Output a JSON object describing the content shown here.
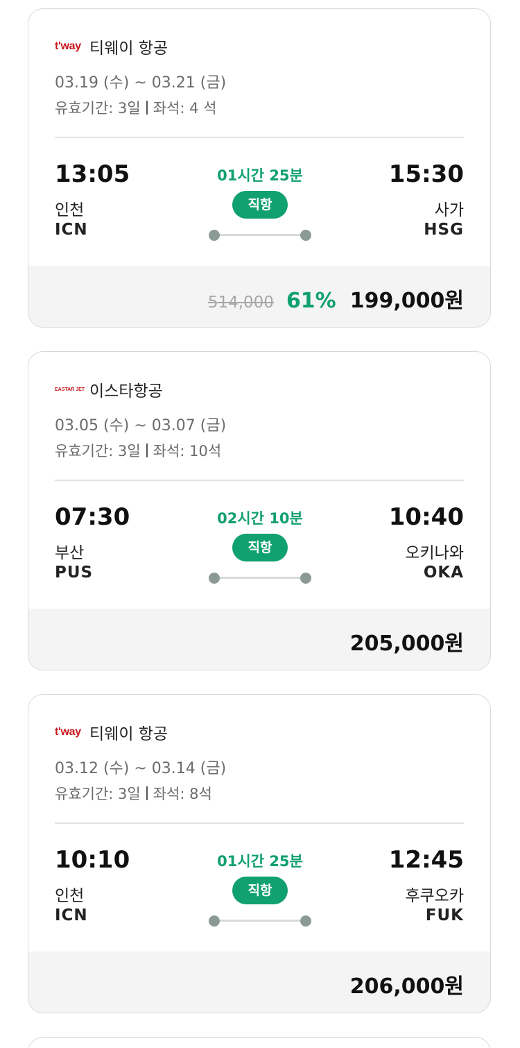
{
  "flights": [
    {
      "airline_logo": "t'way",
      "airline_logo_style": "tway",
      "airline_name": "티웨이 항공",
      "dates": "03.19 (수) ~ 03.21 (금)",
      "validity_label": "유효기간: 3일",
      "seats_label": "좌석: 4 석",
      "dep_time": "13:05",
      "dep_city": "인천",
      "dep_code": "ICN",
      "duration": "01시간 25분",
      "flight_type": "직항",
      "arr_time": "15:30",
      "arr_city": "사가",
      "arr_code": "HSG",
      "original_price": "514,000",
      "discount": "61%",
      "price": "199,000원"
    },
    {
      "airline_logo": "EASTAR JET",
      "airline_logo_style": "eastar",
      "airline_name": "이스타항공",
      "dates": "03.05 (수) ~ 03.07 (금)",
      "validity_label": "유효기간: 3일",
      "seats_label": "좌석: 10석",
      "dep_time": "07:30",
      "dep_city": "부산",
      "dep_code": "PUS",
      "duration": "02시간 10분",
      "flight_type": "직항",
      "arr_time": "10:40",
      "arr_city": "오키나와",
      "arr_code": "OKA",
      "original_price": "",
      "discount": "",
      "price": "205,000원"
    },
    {
      "airline_logo": "t'way",
      "airline_logo_style": "tway",
      "airline_name": "티웨이 항공",
      "dates": "03.12 (수) ~ 03.14 (금)",
      "validity_label": "유효기간: 3일",
      "seats_label": "좌석: 8석",
      "dep_time": "10:10",
      "dep_city": "인천",
      "dep_code": "ICN",
      "duration": "01시간 25분",
      "flight_type": "직항",
      "arr_time": "12:45",
      "arr_city": "후쿠오카",
      "arr_code": "FUK",
      "original_price": "",
      "discount": "",
      "price": "206,000원"
    }
  ],
  "colors": {
    "accent_green": "#11a070",
    "logo_red": "#c8161d",
    "price_panel_bg": "#f4f4f4"
  }
}
